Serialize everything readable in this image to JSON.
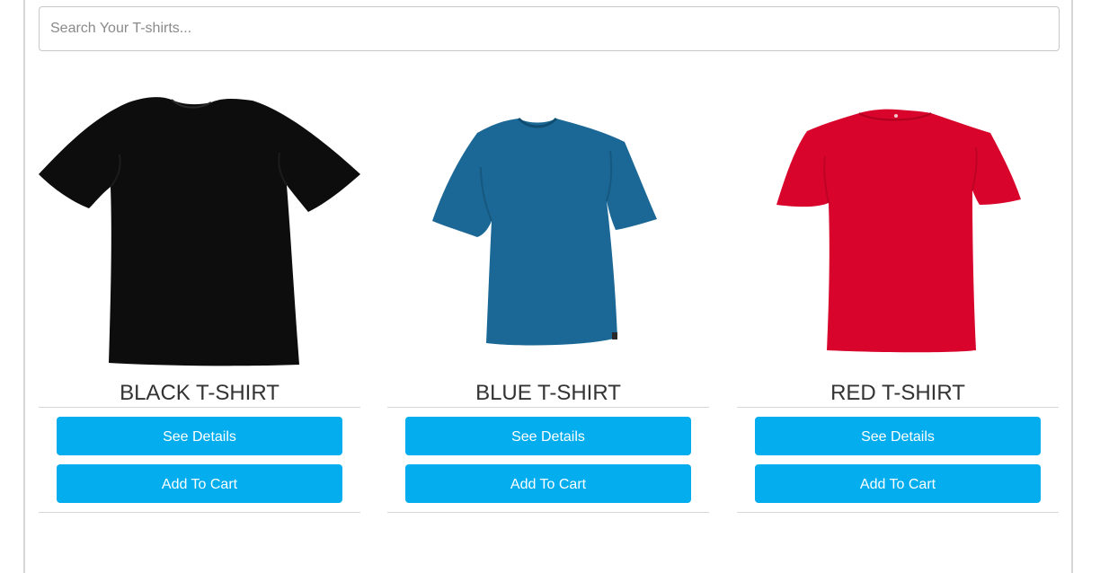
{
  "search": {
    "placeholder": "Search Your T-shirts..."
  },
  "products": [
    {
      "title": "BLACK T-SHIRT",
      "color": "#0d0d0d",
      "details_label": "See Details",
      "cart_label": "Add To Cart"
    },
    {
      "title": "BLUE T-SHIRT",
      "color": "#1b6896",
      "details_label": "See Details",
      "cart_label": "Add To Cart"
    },
    {
      "title": "RED T-SHIRT",
      "color": "#d8042c",
      "details_label": "See Details",
      "cart_label": "Add To Cart"
    }
  ],
  "colors": {
    "button": "#03adee",
    "divider": "#d9d9d9"
  }
}
